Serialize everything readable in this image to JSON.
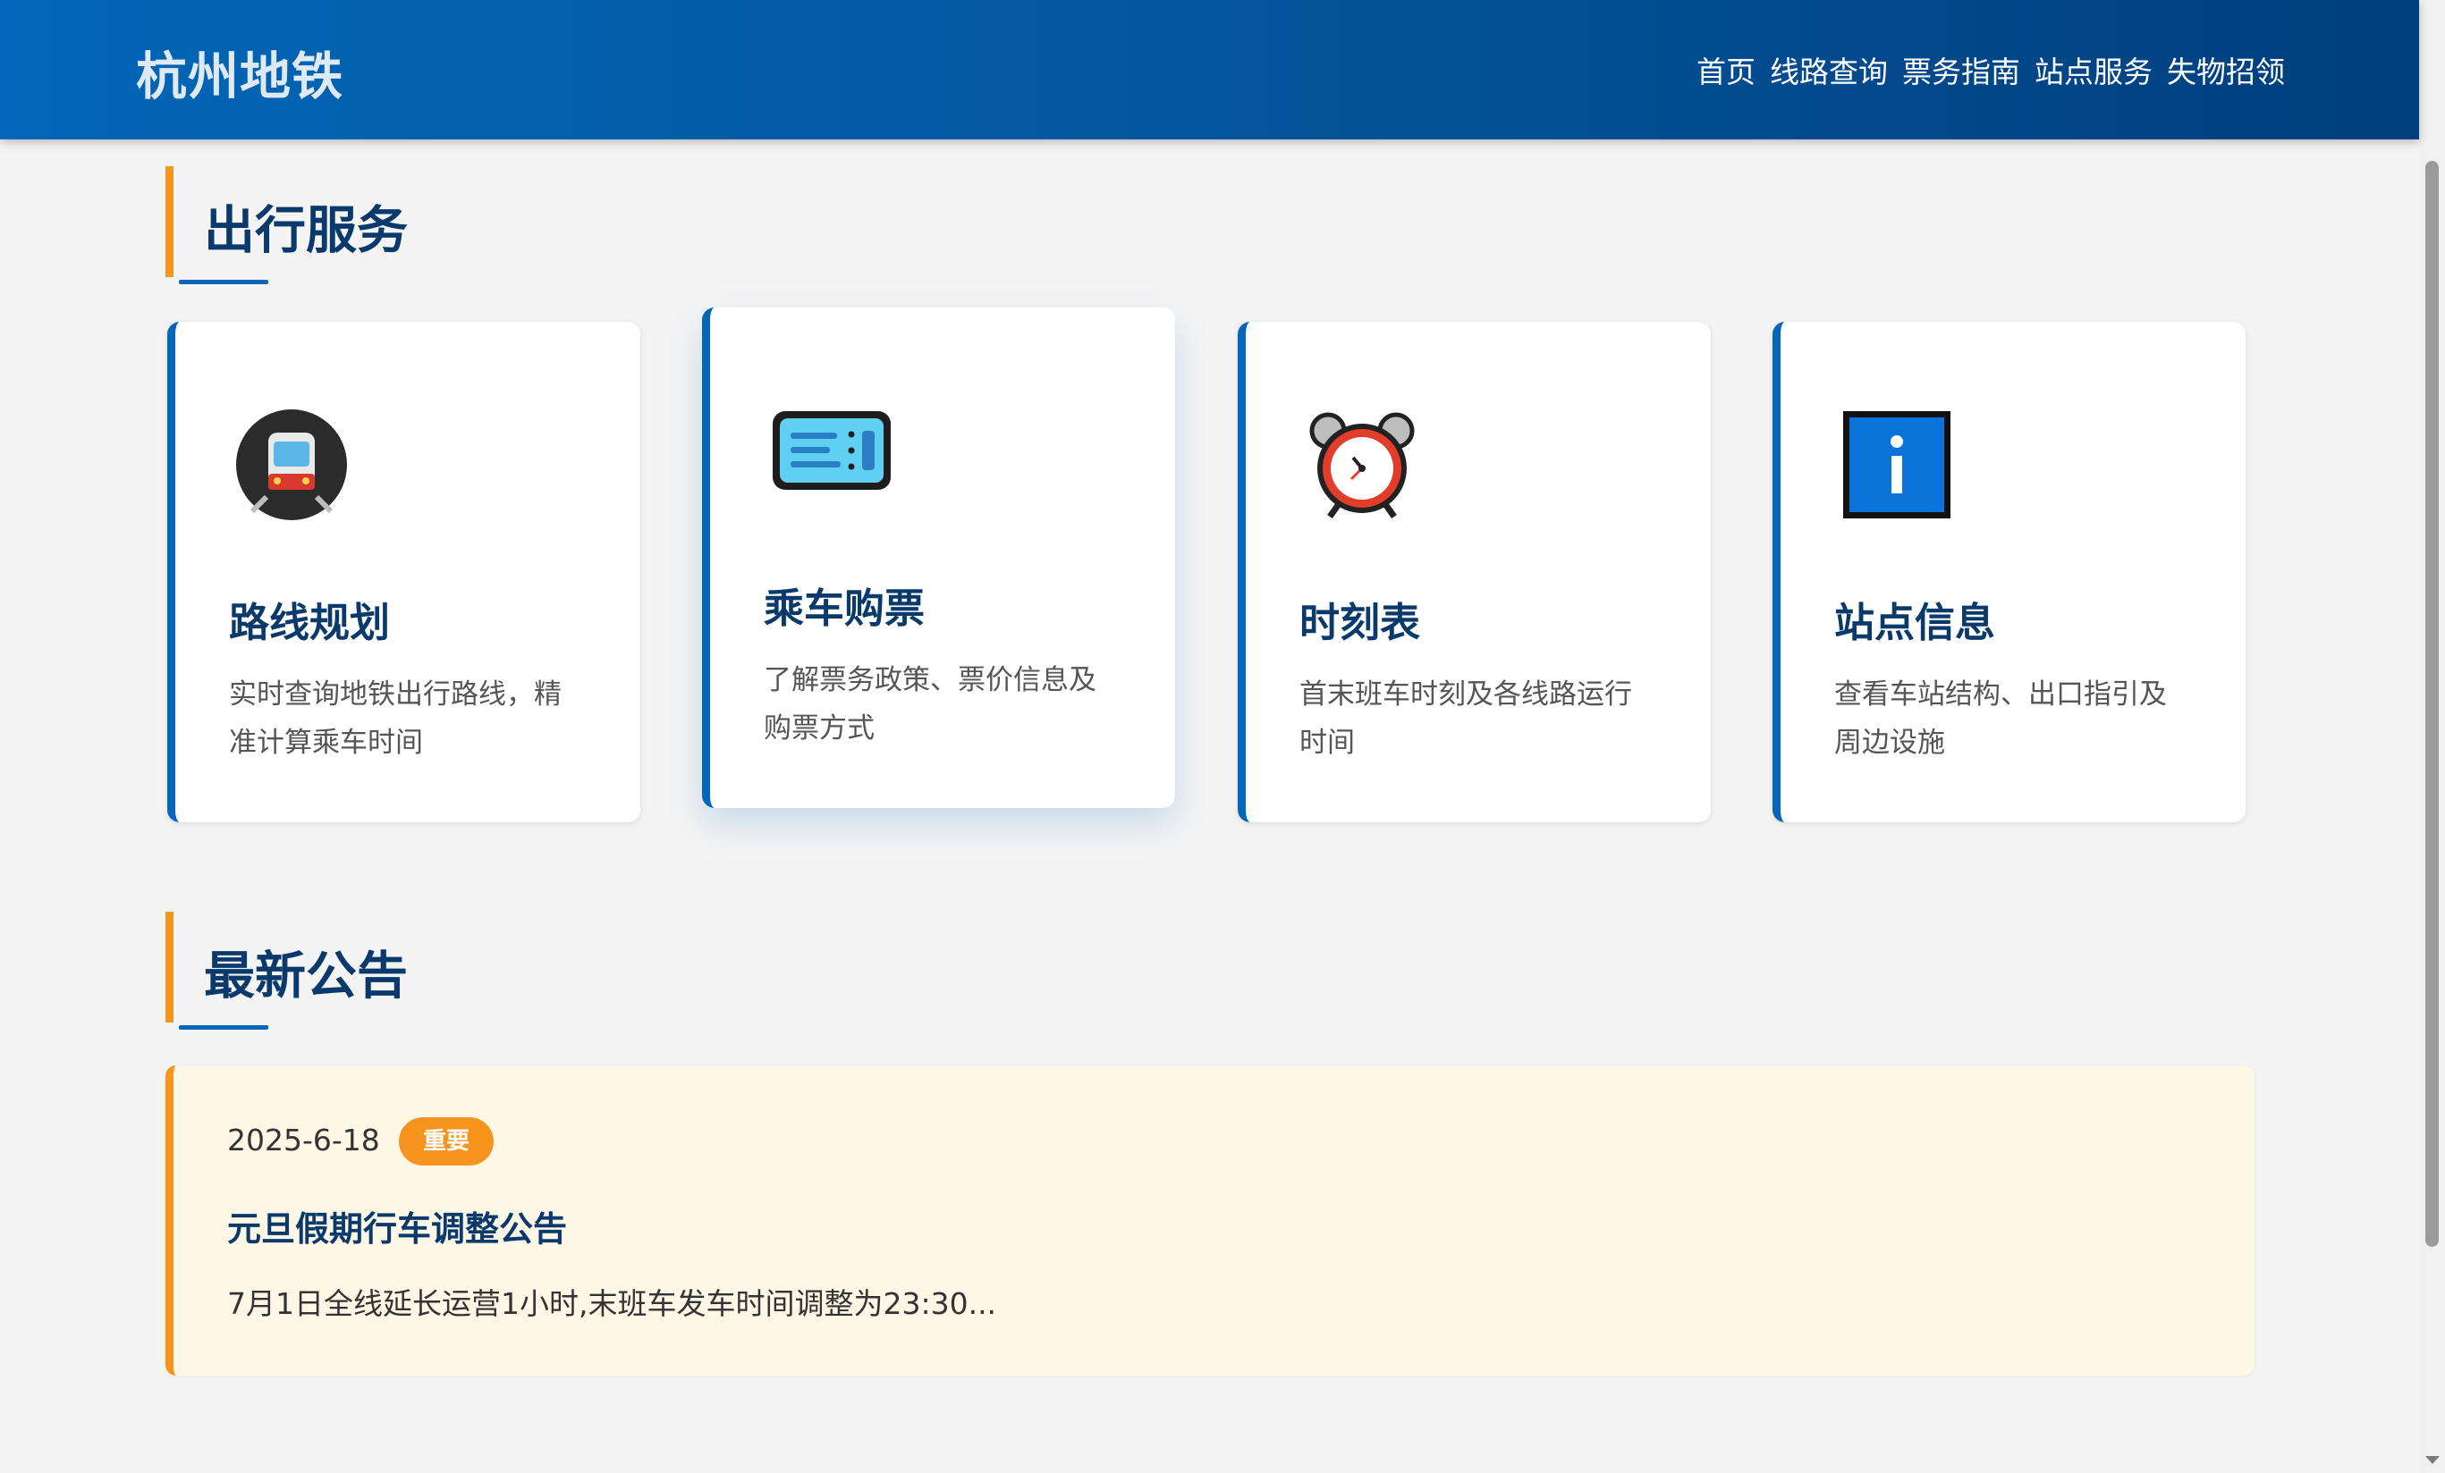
{
  "header": {
    "logo": "杭州地铁",
    "nav": [
      "首页",
      "线路查询",
      "票务指南",
      "站点服务",
      "失物招领"
    ]
  },
  "services": {
    "title": "出行服务",
    "cards": [
      {
        "icon": "metro-train-icon",
        "title": "路线规划",
        "desc": "实时查询地铁出行路线，精准计算乘车时间"
      },
      {
        "icon": "ticket-icon",
        "title": "乘车购票",
        "desc": "了解票务政策、票价信息及购票方式"
      },
      {
        "icon": "alarm-clock-icon",
        "title": "时刻表",
        "desc": "首末班车时刻及各线路运行时间"
      },
      {
        "icon": "information-icon",
        "title": "站点信息",
        "desc": "查看车站结构、出口指引及周边设施"
      }
    ]
  },
  "announcements": {
    "title": "最新公告",
    "items": [
      {
        "date": "2025-6-18",
        "tag": "重要",
        "title": "元旦假期行车调整公告",
        "body": "7月1日全线延长运营1小时,末班车发车时间调整为23:30..."
      }
    ]
  },
  "colors": {
    "primary": "#0366b8",
    "accent": "#f7941d",
    "heading": "#0a3a6b",
    "notice_bg": "#fff7e6"
  }
}
